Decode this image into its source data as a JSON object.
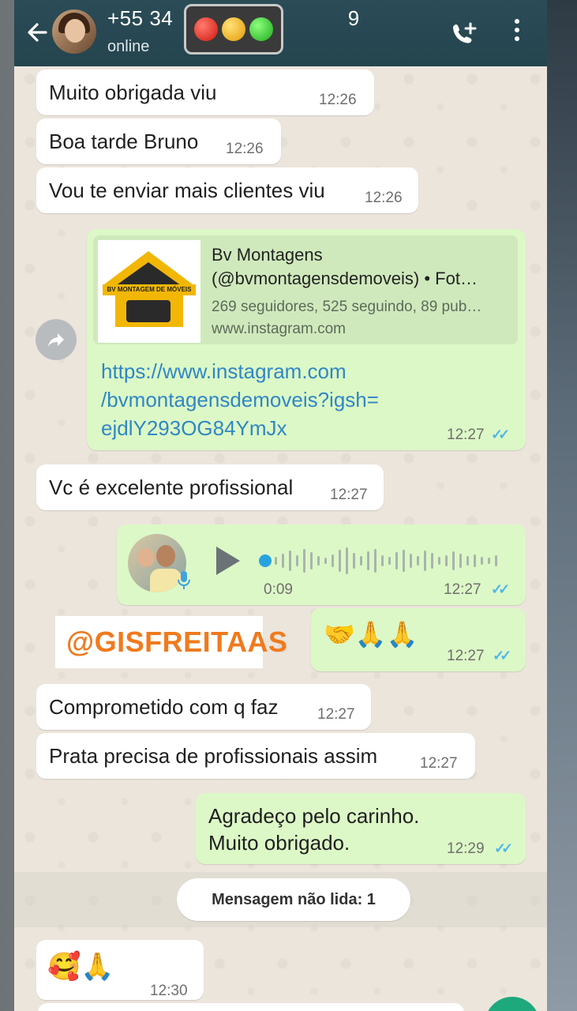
{
  "header": {
    "contact_name": "+55 34",
    "contact_name_tail": "9",
    "status": "online",
    "icons": [
      "back-arrow-icon",
      "add-call-icon",
      "more-vert-icon"
    ]
  },
  "messages": [
    {
      "dir": "in",
      "text": "Muito obrigada viu",
      "time": "12:26"
    },
    {
      "dir": "in",
      "text": "Boa tarde Bruno",
      "time": "12:26"
    },
    {
      "dir": "in",
      "text": "Vou te enviar mais clientes viu",
      "time": "12:26"
    },
    {
      "dir": "out",
      "type": "link",
      "card_title_1": "Bv Montagens",
      "card_title_2": "(@bvmontagensdemoveis) • Fot…",
      "card_desc": "269 seguidores, 525 seguindo, 89 pub…",
      "card_domain": "www.instagram.com",
      "logo_text": "BV MONTAGEM DE MÓVEIS",
      "link_lines": [
        "https://www.instagram.com",
        "/bvmontagensdemoveis?igsh=",
        "ejdlY293OG84YmJx"
      ],
      "time": "12:27"
    },
    {
      "dir": "in",
      "text": "Vc é excelente profissional",
      "time": "12:27"
    },
    {
      "dir": "out",
      "type": "voice",
      "duration": "0:09",
      "time": "12:27"
    },
    {
      "dir": "out",
      "type": "emoji",
      "text": "🤝🙏🙏",
      "time": "12:27"
    },
    {
      "dir": "in",
      "text": "Comprometido com q faz",
      "time": "12:27"
    },
    {
      "dir": "in",
      "text": "Prata precisa de profissionais assim",
      "time": "12:27"
    },
    {
      "dir": "out",
      "lines": [
        "Agradeço pelo carinho.",
        "Muito obrigado."
      ],
      "time": "12:29"
    },
    {
      "dir": "in",
      "type": "emoji",
      "text": "🥰🙏",
      "time": "12:30"
    }
  ],
  "unread_divider": "Mensagem não lida: 1",
  "watermark": "@GISFREITAAS",
  "colors": {
    "header": "#24444e",
    "incoming": "#ffffff",
    "outgoing": "#dcf8c6",
    "link": "#2f87c5",
    "read_ticks": "#4fb6ec",
    "watermark": "#f07a1e"
  }
}
